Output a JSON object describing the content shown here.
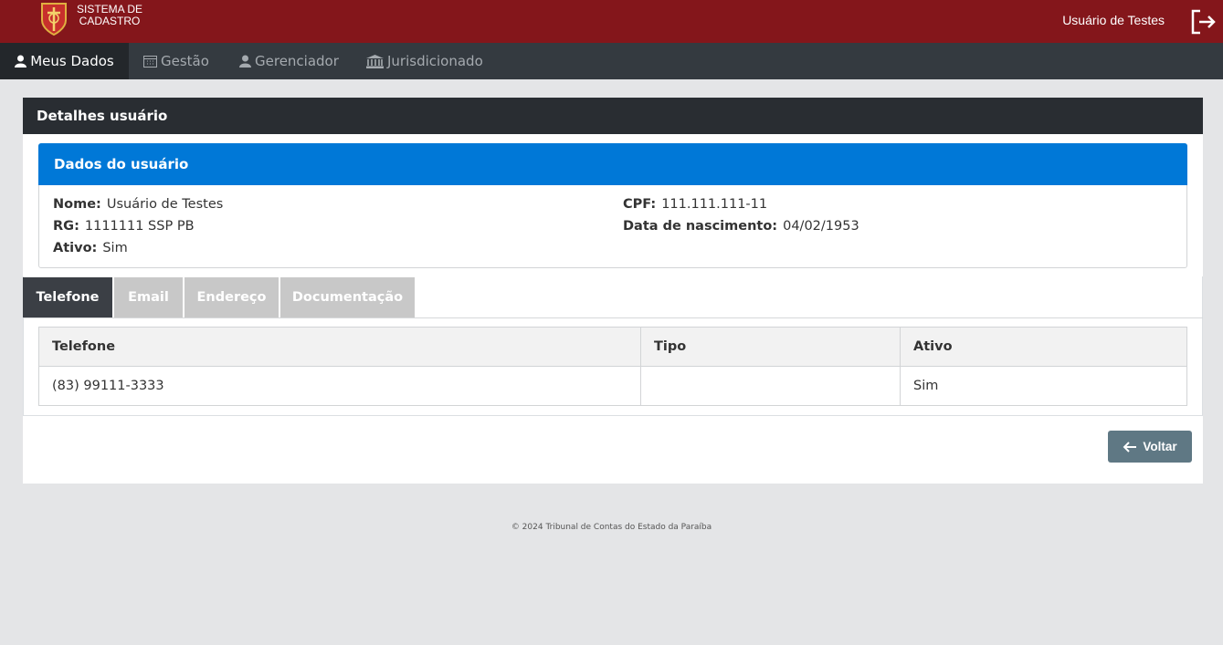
{
  "brand": {
    "line1": "SISTEMA DE",
    "line2": "CADASTRO",
    "logo_icon": "coat-of-arms-icon"
  },
  "header": {
    "user_name": "Usuário de Testes",
    "logout_icon": "logout-icon"
  },
  "nav": {
    "items": [
      {
        "label": "Meus Dados",
        "icon": "user-icon",
        "active": true
      },
      {
        "label": "Gestão",
        "icon": "calendar-icon",
        "active": false
      },
      {
        "label": "Gerenciador",
        "icon": "user-icon",
        "active": false
      },
      {
        "label": "Jurisdicionado",
        "icon": "institution-icon",
        "active": false
      }
    ]
  },
  "card": {
    "title": "Detalhes usuário"
  },
  "user_data": {
    "title": "Dados do usuário",
    "nome_label": "Nome:",
    "nome": "Usuário de Testes",
    "rg_label": "RG:",
    "rg": "1111111 SSP PB",
    "ativo_label": "Ativo:",
    "ativo": "Sim",
    "cpf_label": "CPF:",
    "cpf": "111.111.111-11",
    "nascimento_label": "Data de nascimento:",
    "nascimento": "04/02/1953"
  },
  "tabs": [
    {
      "label": "Telefone",
      "active": true
    },
    {
      "label": "Email",
      "active": false
    },
    {
      "label": "Endereço",
      "active": false
    },
    {
      "label": "Documentação",
      "active": false
    }
  ],
  "phone_table": {
    "headers": [
      "Telefone",
      "Tipo",
      "Ativo"
    ],
    "rows": [
      [
        "(83) 99111-3333",
        "",
        "Sim"
      ]
    ]
  },
  "back_button": {
    "label": "Voltar",
    "icon": "arrow-left-icon"
  },
  "footer": {
    "text": "© 2024 Tribunal de Contas do Estado da Paraíba"
  },
  "colors": {
    "topbar": "#84161b",
    "navbar": "#343a40",
    "primary": "#0078d7",
    "back_button": "#5f7884"
  }
}
